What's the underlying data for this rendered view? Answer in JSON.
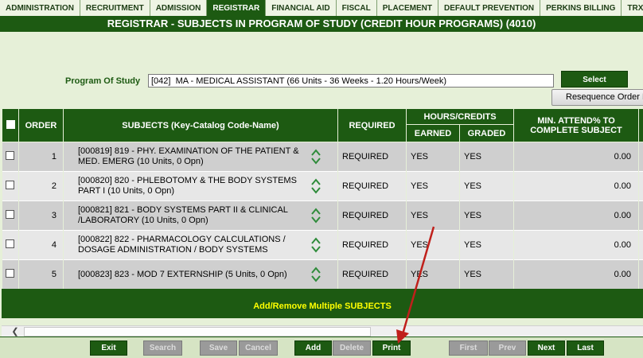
{
  "nav": {
    "tabs": [
      "ADMINISTRATION",
      "RECRUITMENT",
      "ADMISSION",
      "REGISTRAR",
      "FINANCIAL AID",
      "FISCAL",
      "PLACEMENT",
      "DEFAULT PREVENTION",
      "PERKINS BILLING",
      "TRX #:"
    ],
    "active": "REGISTRAR"
  },
  "title": "REGISTRAR - SUBJECTS IN PROGRAM OF STUDY (CREDIT HOUR PROGRAMS) (4010)",
  "program": {
    "label": "Program Of Study",
    "value": "[042]  MA - MEDICAL ASSISTANT (66 Units - 36 Weeks - 1.20 Hours/Week)",
    "select_label": "Select",
    "resequence_label": "Resequence Order B"
  },
  "table": {
    "headers": {
      "order": "ORDER",
      "subjects": "SUBJECTS (Key-Catalog Code-Name)",
      "required": "REQUIRED",
      "hours_credits": "HOURS/CREDITS",
      "earned": "EARNED",
      "graded": "GRADED",
      "min_attend": "MIN. ATTEND% TO COMPLETE SUBJECT"
    },
    "rows": [
      {
        "order": "1",
        "subject": "[000819] 819 - PHY. EXAMINATION OF THE PATIENT & MED. EMERG (10 Units, 0 Opn)",
        "required": "REQUIRED",
        "earned": "YES",
        "graded": "YES",
        "min_attend": "0.00"
      },
      {
        "order": "2",
        "subject": "[000820] 820 - PHLEBOTOMY & THE BODY SYSTEMS PART I (10 Units, 0 Opn)",
        "required": "REQUIRED",
        "earned": "YES",
        "graded": "YES",
        "min_attend": "0.00"
      },
      {
        "order": "3",
        "subject": "[000821] 821 - BODY SYSTEMS PART II & CLINICAL /LABORATORY (10 Units, 0 Opn)",
        "required": "REQUIRED",
        "earned": "YES",
        "graded": "YES",
        "min_attend": "0.00"
      },
      {
        "order": "4",
        "subject": "[000822] 822 - PHARMACOLOGY CALCULATIONS / DOSAGE ADMINISTRATION / BODY SYSTEMS",
        "required": "REQUIRED",
        "earned": "YES",
        "graded": "YES",
        "min_attend": "0.00"
      },
      {
        "order": "5",
        "subject": "[000823] 823 - MOD 7 EXTERNSHIP (5 Units, 0 Opn)",
        "required": "REQUIRED",
        "earned": "YES",
        "graded": "YES",
        "min_attend": "0.00"
      }
    ]
  },
  "add_remove_label": "Add/Remove Multiple SUBJECTS",
  "toolbar": {
    "exit": "Exit",
    "search": "Search",
    "save": "Save",
    "cancel": "Cancel",
    "add": "Add",
    "delete": "Delete",
    "print": "Print",
    "first": "First",
    "prev": "Prev",
    "next": "Next",
    "last": "Last"
  },
  "colors": {
    "primary_green": "#1d5a12",
    "page_bg": "#e6f0d8",
    "link_yellow": "#ffff00",
    "annotation_red": "#c0201b"
  },
  "icons": {
    "move_up": "chevron-up-icon",
    "move_down": "chevron-down-icon",
    "scroll_left": "chevron-left-icon"
  }
}
